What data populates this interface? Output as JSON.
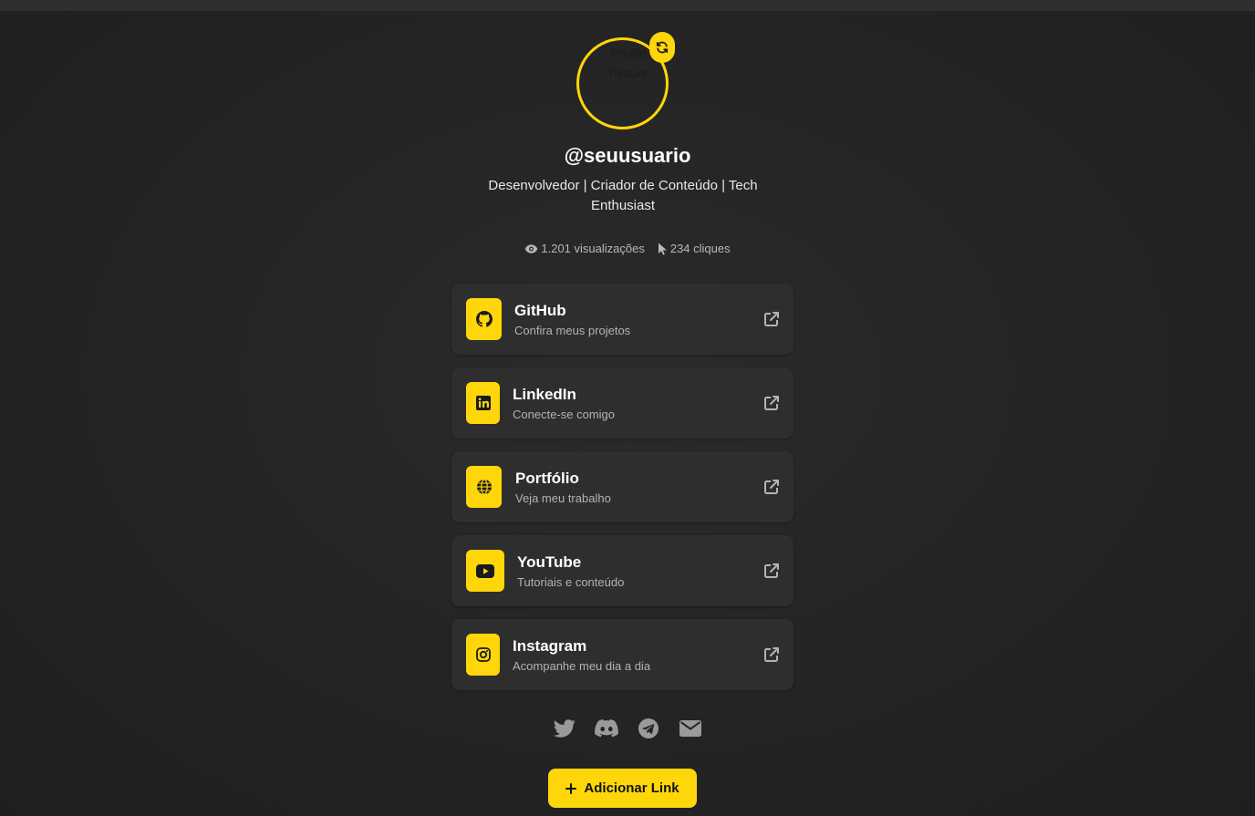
{
  "profile": {
    "avatar_alt": "Profile Picture",
    "username": "@seuusuario",
    "bio": "Desenvolvedor | Criador de Conteúdo | Tech Enthusiast"
  },
  "stats": {
    "views": "1.201 visualizações",
    "clicks": "234 cliques"
  },
  "links": [
    {
      "title": "GitHub",
      "subtitle": "Confira meus projetos",
      "icon": "github-icon"
    },
    {
      "title": "LinkedIn",
      "subtitle": "Conecte-se comigo",
      "icon": "linkedin-icon"
    },
    {
      "title": "Portfólio",
      "subtitle": "Veja meu trabalho",
      "icon": "globe-icon"
    },
    {
      "title": "YouTube",
      "subtitle": "Tutoriais e conteúdo",
      "icon": "youtube-icon"
    },
    {
      "title": "Instagram",
      "subtitle": "Acompanhe meu dia a dia",
      "icon": "instagram-icon"
    }
  ],
  "socials": [
    "twitter-icon",
    "discord-icon",
    "telegram-icon",
    "email-icon"
  ],
  "add_button": {
    "label": "Adicionar Link"
  },
  "colors": {
    "accent": "#FFD60A",
    "background": "#232323",
    "card": "#2e2e2e",
    "muted": "#b3b3b3"
  }
}
